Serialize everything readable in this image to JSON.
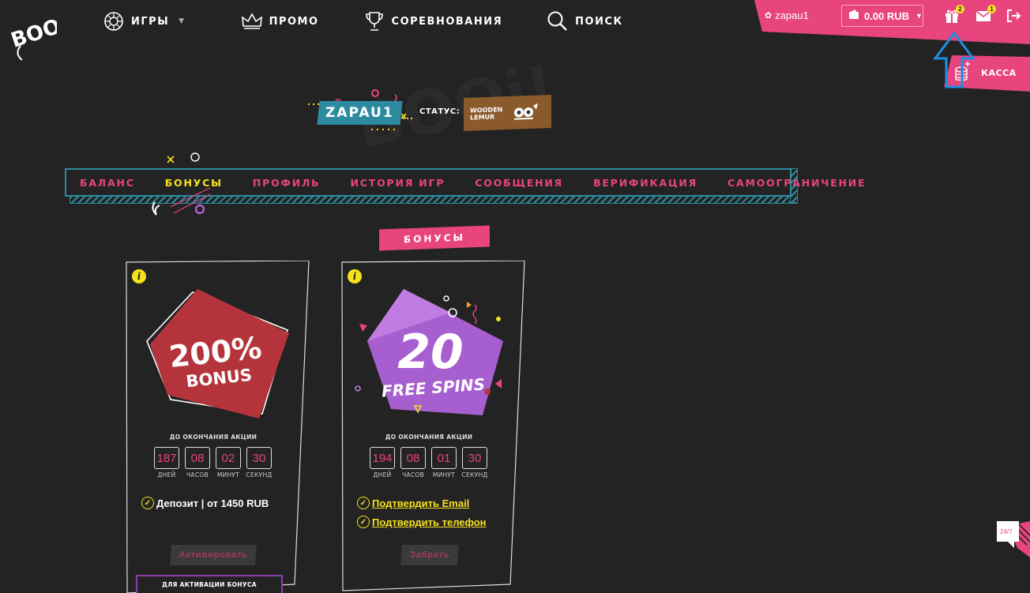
{
  "header": {
    "logo_text": "BOOi!",
    "nav": [
      {
        "label": "ИГРЫ",
        "icon": "roulette-icon",
        "has_dropdown": true
      },
      {
        "label": "ПРОМО",
        "icon": "crown-icon"
      },
      {
        "label": "СОРЕВНОВАНИЯ",
        "icon": "trophy-icon"
      },
      {
        "label": "ПОИСК",
        "icon": "search-icon"
      }
    ],
    "user": {
      "name": "zapau1",
      "balance": "0.00 RUB"
    },
    "gift_count": "2",
    "message_count": "1",
    "cashier_label": "КАССА"
  },
  "profile": {
    "username": "ZAPAU1",
    "status_label": "СТАТУС:",
    "status_name": "WOODEN LEMUR"
  },
  "tabs": [
    {
      "label": "БАЛАНС",
      "active": false
    },
    {
      "label": "БОНУСЫ",
      "active": true
    },
    {
      "label": "ПРОФИЛЬ",
      "active": false
    },
    {
      "label": "ИСТОРИЯ ИГР",
      "active": false
    },
    {
      "label": "СООБЩЕНИЯ",
      "active": false
    },
    {
      "label": "ВЕРИФИКАЦИЯ",
      "active": false
    },
    {
      "label": "САМООГРАНИЧЕНИЕ",
      "active": false
    }
  ],
  "section_title": "БОНУСЫ",
  "bonuses": [
    {
      "art_line1": "200%",
      "art_line2": "BONUS",
      "ends_label": "ДО ОКОНЧАНИЯ АКЦИИ",
      "timer": [
        {
          "value": "187",
          "unit": "ДНЕЙ"
        },
        {
          "value": "08",
          "unit": "ЧАСОВ"
        },
        {
          "value": "02",
          "unit": "МИНУТ"
        },
        {
          "value": "30",
          "unit": "СЕКУНД"
        }
      ],
      "requirements": [
        "Депозит | от 1450 RUB"
      ],
      "button": "Активировать",
      "note": "ДЛЯ АКТИВАЦИИ БОНУСА"
    },
    {
      "art_line1": "20",
      "art_line2": "FREE SPINS",
      "ends_label": "ДО ОКОНЧАНИЯ АКЦИИ",
      "timer": [
        {
          "value": "194",
          "unit": "ДНЕЙ"
        },
        {
          "value": "08",
          "unit": "ЧАСОВ"
        },
        {
          "value": "01",
          "unit": "МИНУТ"
        },
        {
          "value": "30",
          "unit": "СЕКУНД"
        }
      ],
      "requirements": [
        "Подтвердить Email",
        "Подтвердить телефон"
      ],
      "button": "Забрать"
    }
  ],
  "support_label": "24/7",
  "colors": {
    "pink": "#e8457f",
    "teal": "#2d8ba0",
    "yellow": "#f7e11c",
    "bg": "#232323",
    "red_badge": "#b5343c",
    "purple_badge": "#a75fd0"
  }
}
